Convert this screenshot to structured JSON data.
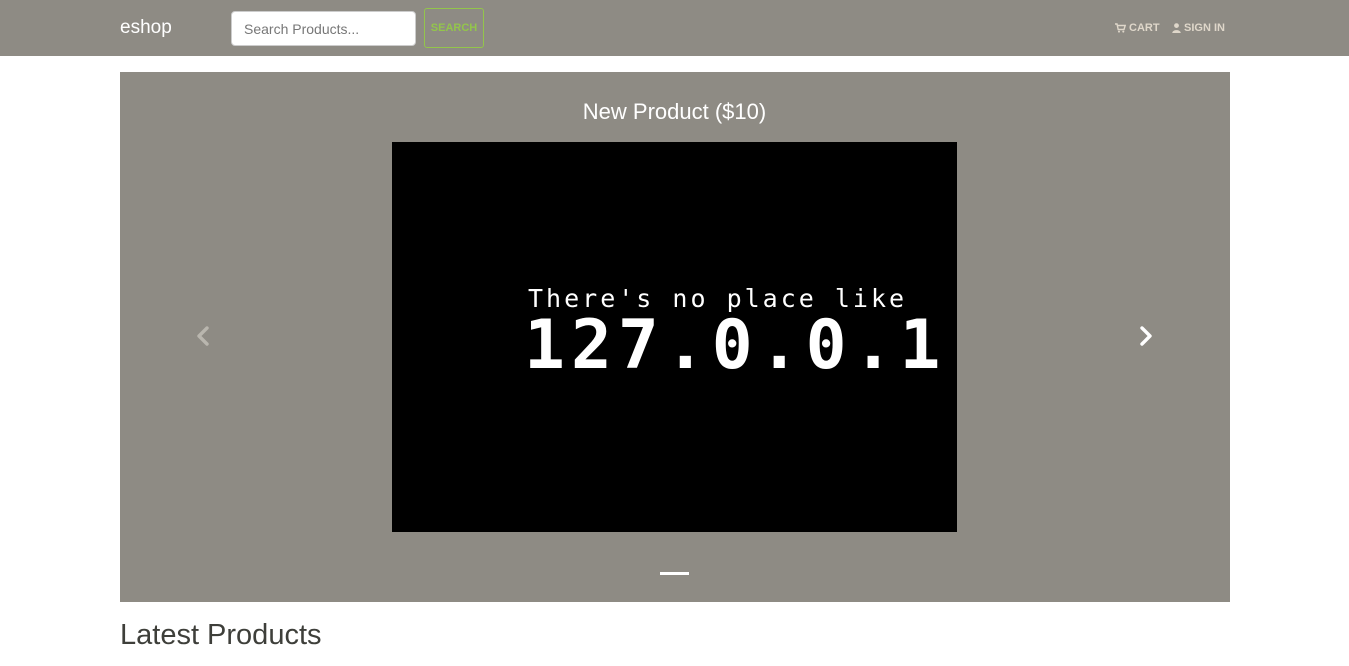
{
  "navbar": {
    "brand": "eshop",
    "search": {
      "placeholder": "Search Products...",
      "value": "",
      "button_label": "SEARCH"
    },
    "links": [
      {
        "label": "CART",
        "icon": "shopping-cart-icon"
      },
      {
        "label": "SIGN IN",
        "icon": "user-icon"
      }
    ]
  },
  "carousel": {
    "slide_title": "New Product ($10)",
    "image_text": {
      "line1": "There's no place like",
      "line2": "127.0.0.1"
    },
    "prev_icon": "chevron-left-icon",
    "next_icon": "chevron-right-icon",
    "active_indicator": 1,
    "indicator_count": 1
  },
  "sections": {
    "latest_products_title": "Latest Products"
  },
  "colors": {
    "navbar_bg": "#8e8b84",
    "accent_green": "#93c54b",
    "nav_link": "#dfd7ca",
    "heading_text": "#3e3f3a"
  }
}
